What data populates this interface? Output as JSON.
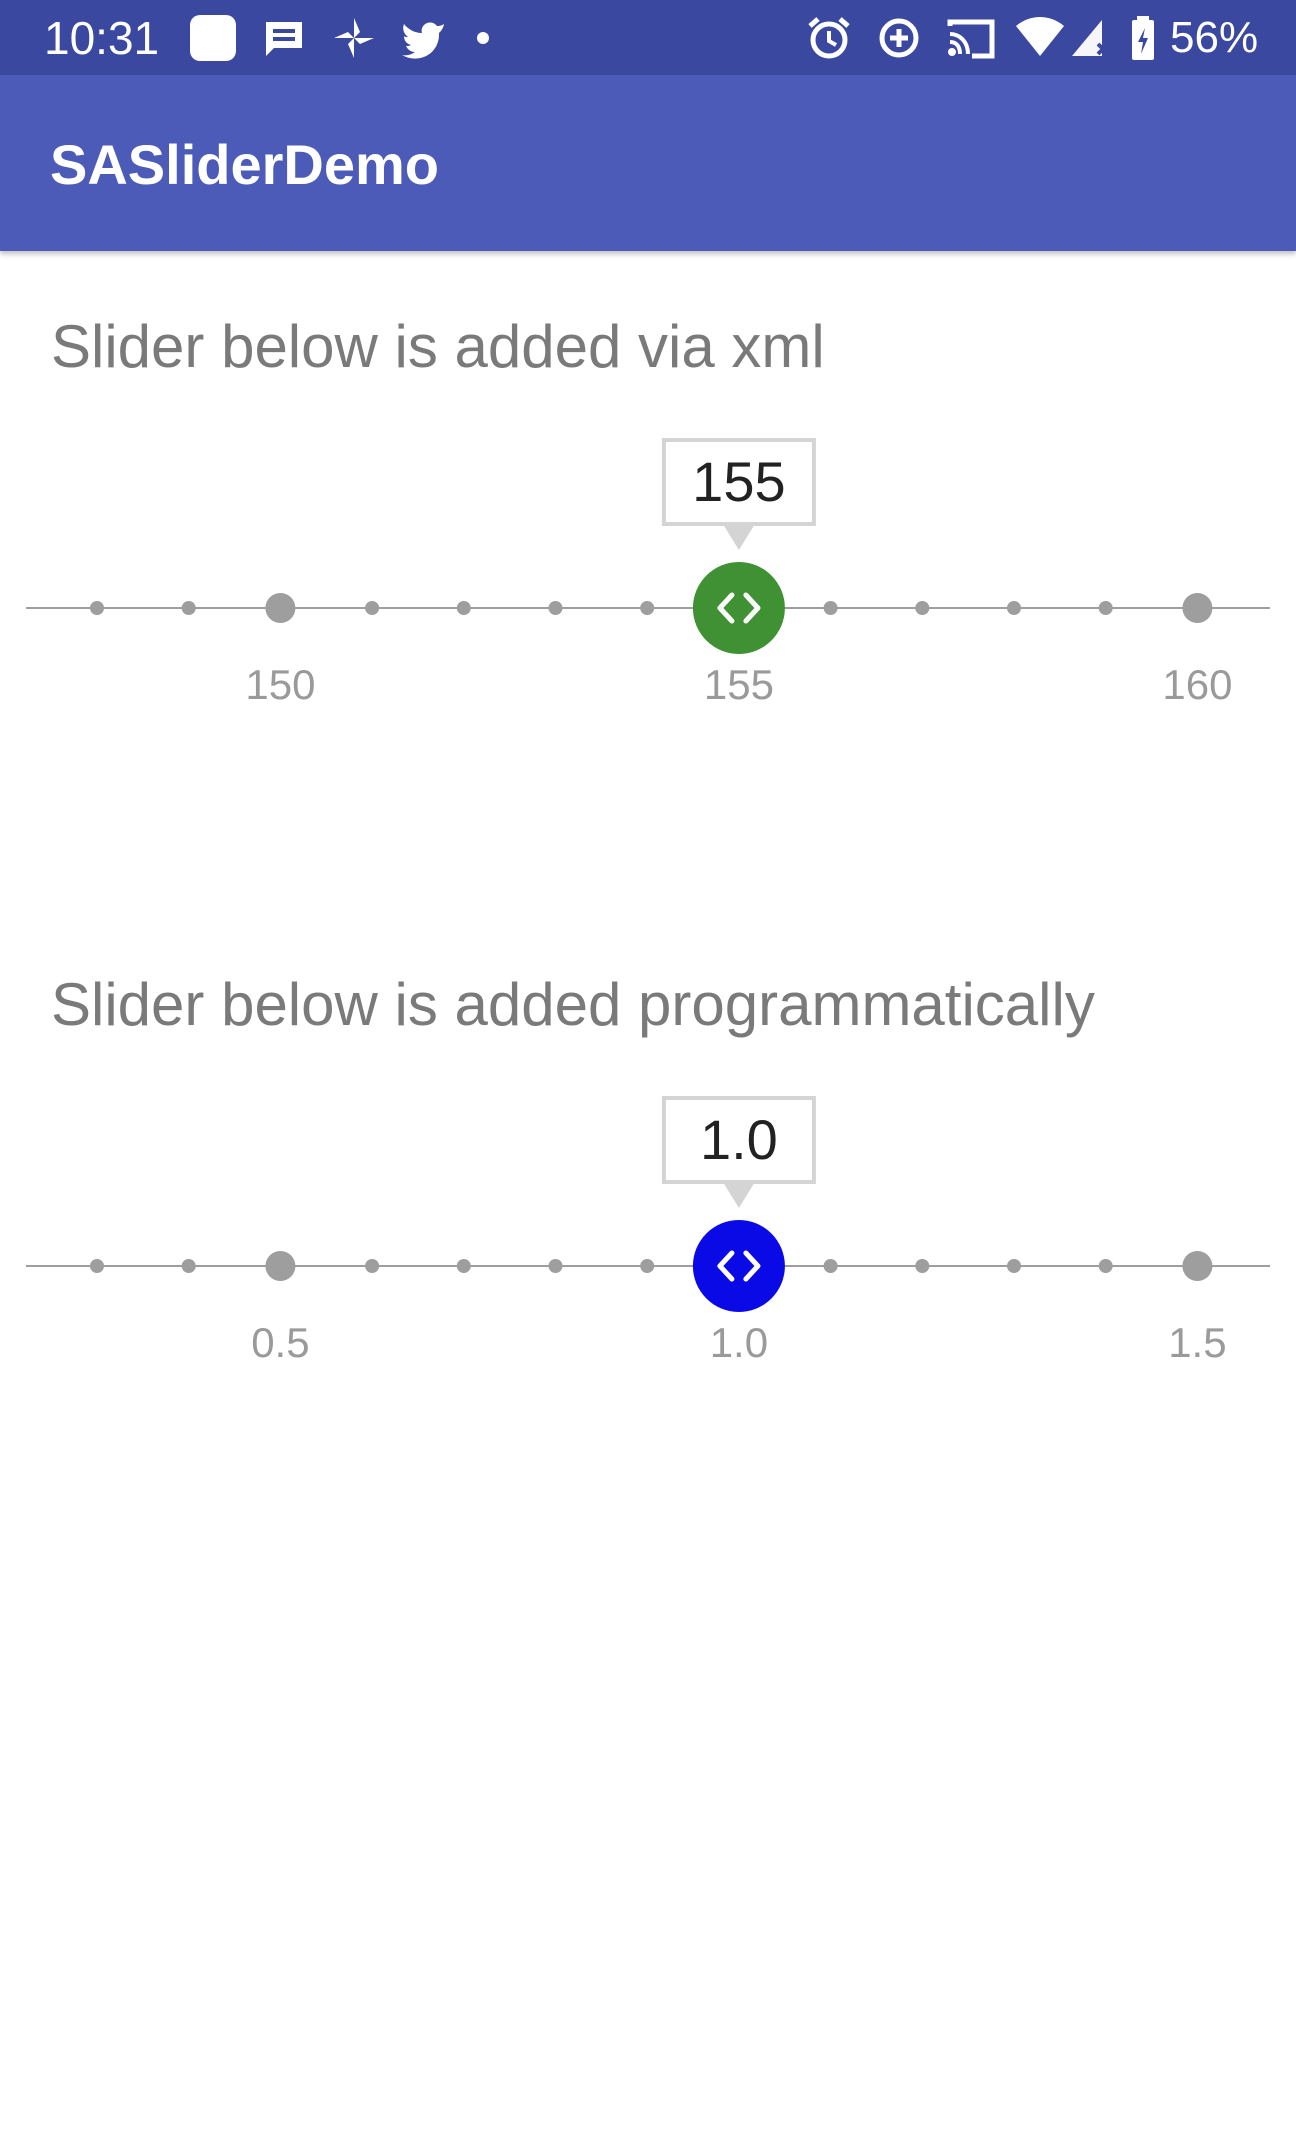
{
  "status_bar": {
    "time": "10:31",
    "battery_percent": "56%",
    "left_icons": [
      "app-icon",
      "messages-icon",
      "pinwheel-icon",
      "twitter-icon",
      "dot-icon"
    ],
    "right_icons": [
      "alarm-icon",
      "data-saver-icon",
      "cast-icon",
      "wifi-icon",
      "signal-icon",
      "battery-icon"
    ],
    "background": "#3a48a0"
  },
  "app_bar": {
    "title": "SASliderDemo",
    "background": "#4d5bb8"
  },
  "sections": [
    {
      "label": "Slider below is added via xml",
      "slider": {
        "value": "155",
        "min_tick_value": 148,
        "tick_step": 1,
        "tick_count": 13,
        "selected_value": 155,
        "major_ticks": [
          150,
          155,
          160
        ],
        "tick_labels": [
          "150",
          "155",
          "160"
        ],
        "thumb_color": "#3f9134",
        "thumb_icon": "code-arrows-icon"
      }
    },
    {
      "label": "Slider below is added programmatically",
      "slider": {
        "value": "1.0",
        "min_tick_value": 0.3,
        "tick_step": 0.1,
        "tick_count": 13,
        "selected_value": 1.0,
        "major_ticks": [
          0.5,
          1.0,
          1.5
        ],
        "tick_labels": [
          "0.5",
          "1.0",
          "1.5"
        ],
        "thumb_color": "#0a0ae6",
        "thumb_icon": "code-arrows-icon"
      }
    }
  ]
}
